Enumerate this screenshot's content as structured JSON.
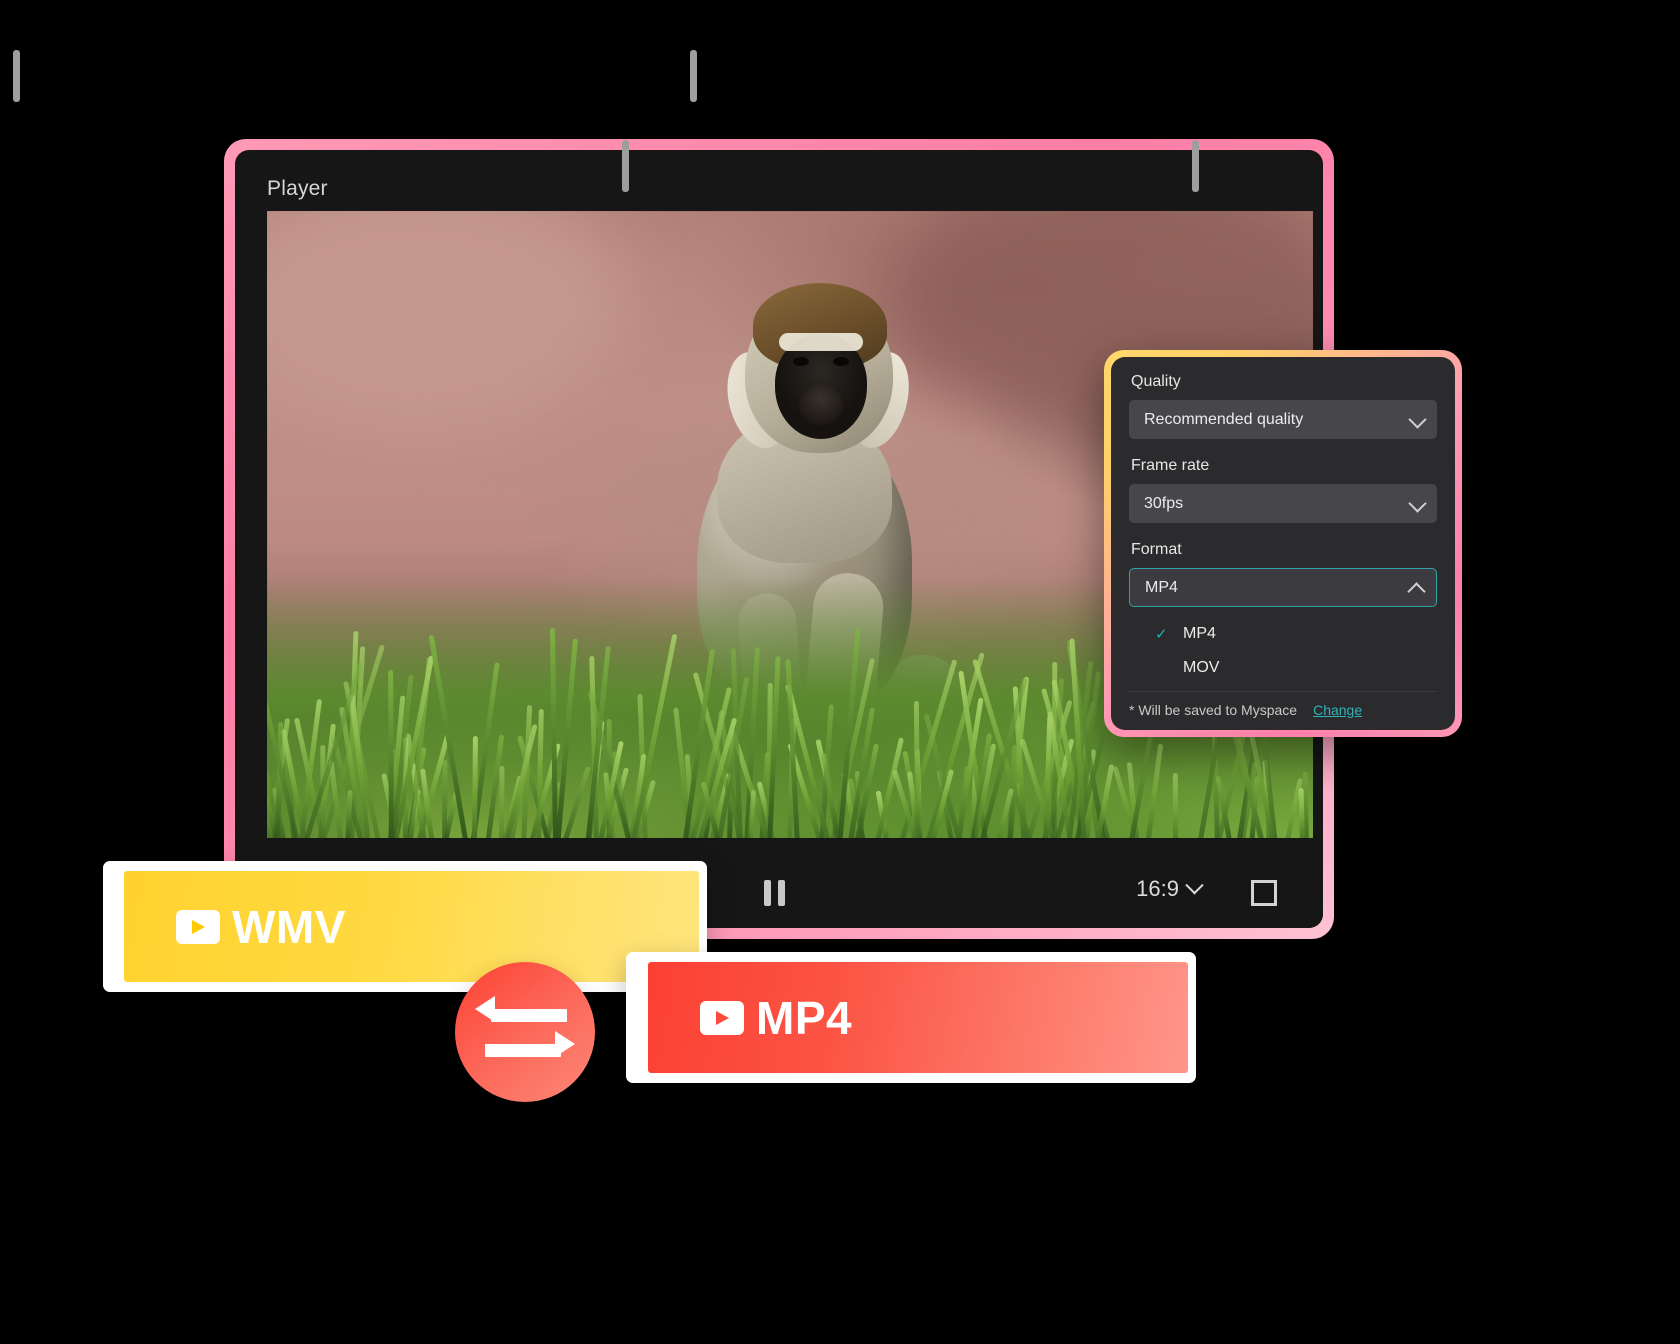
{
  "player": {
    "title": "Player",
    "controls": {
      "pause_label": "Pause",
      "aspect_ratio": "16:9",
      "fullscreen_label": "Fullscreen"
    }
  },
  "export_panel": {
    "quality": {
      "label": "Quality",
      "value": "Recommended quality"
    },
    "frame_rate": {
      "label": "Frame rate",
      "value": "30fps"
    },
    "format": {
      "label": "Format",
      "value": "MP4",
      "options": [
        {
          "label": "MP4",
          "selected": true
        },
        {
          "label": "MOV",
          "selected": false
        }
      ]
    },
    "footer": {
      "note": "* Will be saved to Myspace",
      "change_label": "Change"
    },
    "colors": {
      "accent_teal": "#2fb3b8",
      "border_gradient_start": "#ffd86b",
      "border_gradient_end": "#ff96b6"
    }
  },
  "format_badges": {
    "source": {
      "label": "WMV",
      "icon": "video-play-icon",
      "color": "#ffd22e"
    },
    "target": {
      "label": "MP4",
      "icon": "video-play-icon",
      "color": "#fb4033"
    },
    "swap_icon": "swap-arrows-icon"
  }
}
